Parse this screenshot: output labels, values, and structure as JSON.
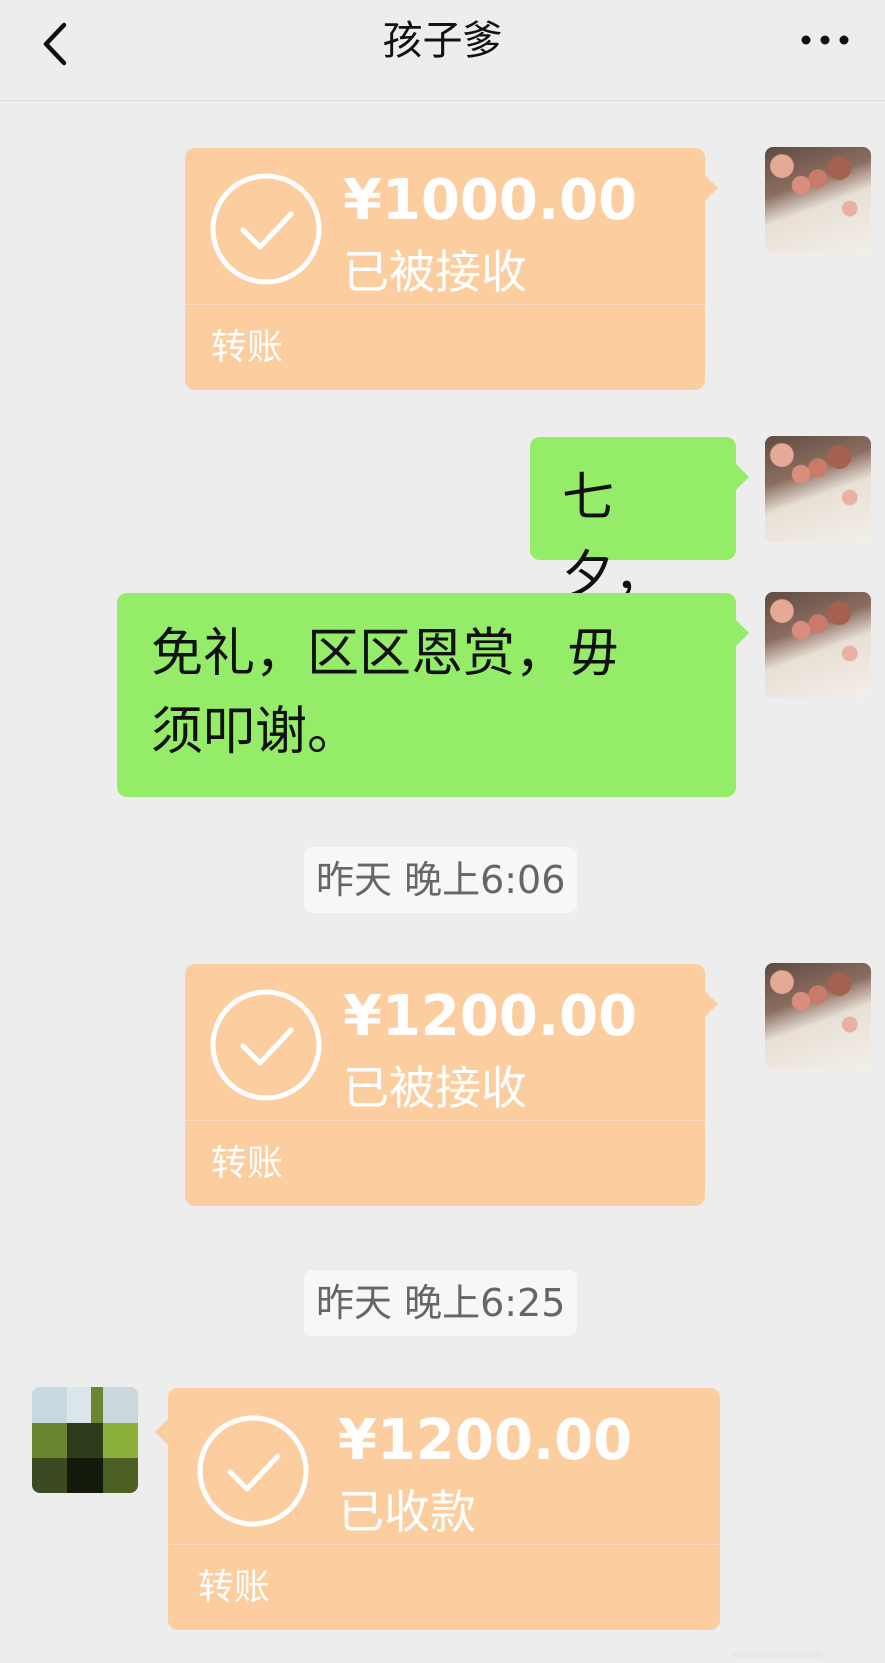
{
  "header": {
    "title": "孩子爹"
  },
  "messages": {
    "m1": {
      "amount": "¥1000.00",
      "status": "已被接收",
      "type": "转账"
    },
    "m2": {
      "text": "七夕，"
    },
    "m3": {
      "line1": "免礼，区区恩赏，毋",
      "line2": "须叩谢。"
    },
    "t1": {
      "text": "昨天 晚上6:06"
    },
    "m4": {
      "amount": "¥1200.00",
      "status": "已被接收",
      "type": "转账"
    },
    "t2": {
      "text": "昨天 晚上6:25"
    },
    "m5": {
      "amount": "¥1200.00",
      "status": "已收款",
      "type": "转账"
    }
  },
  "colors": {
    "background": "#ededed",
    "transfer_bubble": "#fcce9f",
    "text_bubble": "#95ec69"
  },
  "icons": [
    "back-chevron-icon",
    "more-dots-icon",
    "check-circle-icon"
  ]
}
